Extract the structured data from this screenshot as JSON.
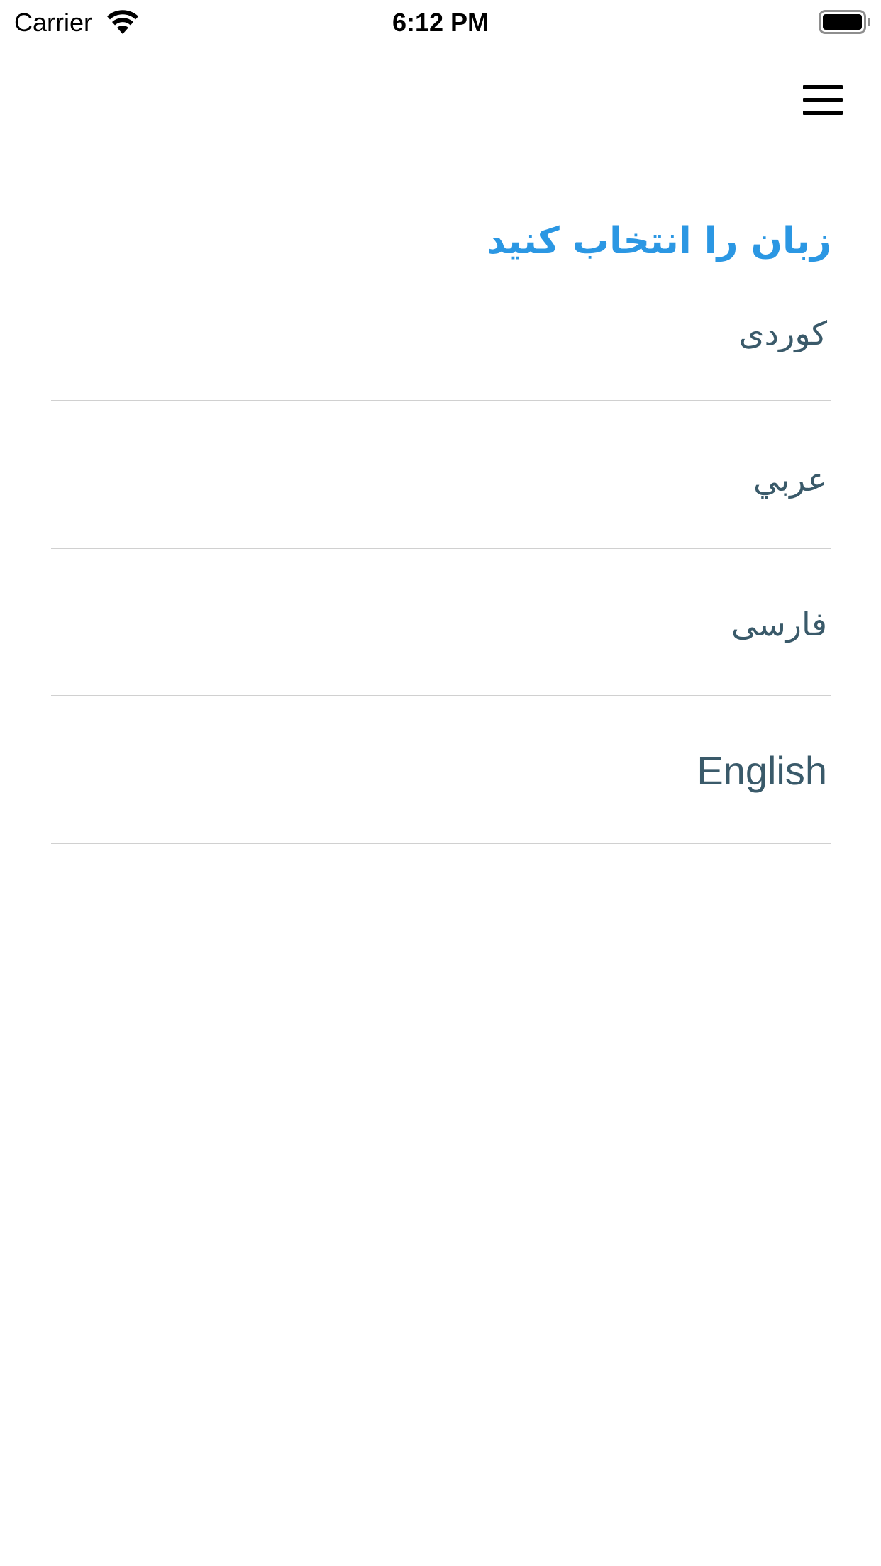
{
  "status_bar": {
    "carrier": "Carrier",
    "time": "6:12 PM",
    "wifi_icon": "wifi-icon",
    "battery_icon": "battery-full-icon"
  },
  "nav": {
    "menu_icon": "hamburger-menu-icon"
  },
  "page": {
    "title": "زبان را انتخاب کنید"
  },
  "languages": [
    {
      "label": "کوردی"
    },
    {
      "label": "عربي"
    },
    {
      "label": "فارسی"
    },
    {
      "label": "English"
    }
  ],
  "colors": {
    "title": "#2b97e3",
    "item_text": "#3a5a6a",
    "divider": "#d0d0d0",
    "background": "#ffffff"
  }
}
